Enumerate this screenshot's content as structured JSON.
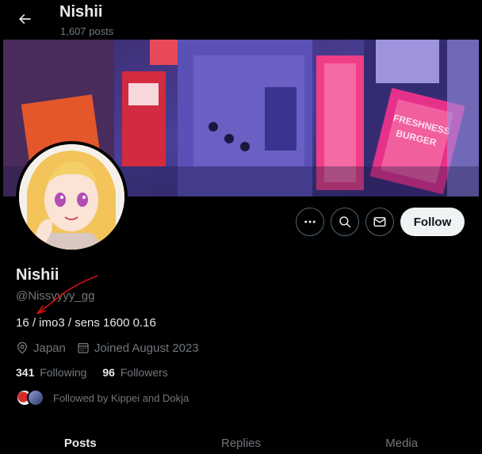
{
  "header": {
    "title": "Nishii",
    "post_count": "1,607 posts"
  },
  "profile": {
    "display_name": "Nishii",
    "handle": "@Nissyyyy_gg",
    "bio": "16 / imo3 / sens 1600 0.16",
    "location": "Japan",
    "joined": "Joined August 2023",
    "following_count": "341",
    "following_label": "Following",
    "followers_count": "96",
    "followers_label": "Followers",
    "followed_by": "Followed by Kippei and Dokja"
  },
  "actions": {
    "follow_label": "Follow",
    "more_icon": "more-icon",
    "search_icon": "search-icon",
    "message_icon": "mail-icon"
  },
  "banner": {
    "sign_1": "FRESHNESS",
    "sign_2": "BURGER"
  },
  "tabs": [
    {
      "label": "Posts",
      "active": true
    },
    {
      "label": "Replies",
      "active": false
    },
    {
      "label": "Media",
      "active": false
    }
  ],
  "colors": {
    "background": "#000000",
    "text_primary": "#e7e9ea",
    "text_secondary": "#71767b",
    "follow_button": "#eff3f4",
    "annotation": "#d01010"
  }
}
